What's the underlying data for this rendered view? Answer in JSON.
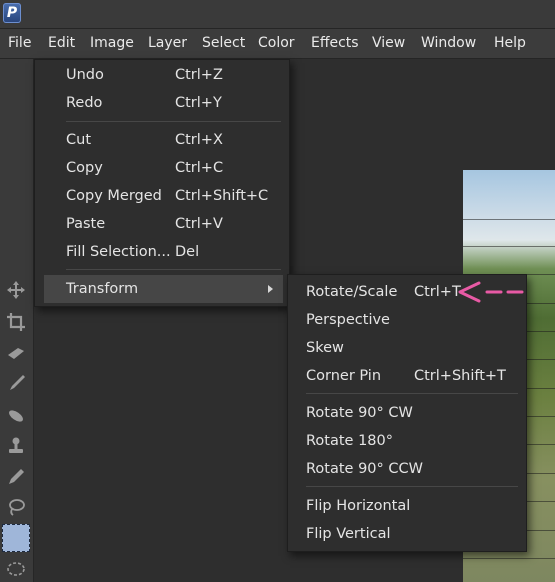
{
  "app": {
    "logo_letter": "P"
  },
  "menubar": [
    "File",
    "Edit",
    "Image",
    "Layer",
    "Select",
    "Color",
    "Effects",
    "View",
    "Window",
    "Help"
  ],
  "edit_menu": {
    "items": [
      {
        "label": "Undo",
        "shortcut": "Ctrl+Z"
      },
      {
        "label": "Redo",
        "shortcut": "Ctrl+Y"
      },
      {
        "label": "Cut",
        "shortcut": "Ctrl+X"
      },
      {
        "label": "Copy",
        "shortcut": "Ctrl+C"
      },
      {
        "label": "Copy Merged",
        "shortcut": "Ctrl+Shift+C"
      },
      {
        "label": "Paste",
        "shortcut": "Ctrl+V"
      },
      {
        "label": "Fill Selection...",
        "shortcut": "Del"
      },
      {
        "label": "Transform",
        "shortcut": ""
      }
    ],
    "highlighted": "Transform"
  },
  "transform_submenu": {
    "items": [
      {
        "label": "Rotate/Scale",
        "shortcut": "Ctrl+T"
      },
      {
        "label": "Perspective",
        "shortcut": ""
      },
      {
        "label": "Skew",
        "shortcut": ""
      },
      {
        "label": "Corner Pin",
        "shortcut": "Ctrl+Shift+T"
      },
      {
        "label": "Rotate 90° CW",
        "shortcut": ""
      },
      {
        "label": "Rotate 180°",
        "shortcut": ""
      },
      {
        "label": "Rotate 90° CCW",
        "shortcut": ""
      },
      {
        "label": "Flip Horizontal",
        "shortcut": ""
      },
      {
        "label": "Flip Vertical",
        "shortcut": ""
      }
    ]
  },
  "tools": [
    "move-icon",
    "crop-icon",
    "eraser-icon",
    "brush-icon",
    "smudge-icon",
    "clone-stamp-icon",
    "pen-icon",
    "lasso-icon",
    "rect-select-icon",
    "ellipse-select-icon"
  ],
  "colors": {
    "annotation": "#e85aa5",
    "highlight": "#464646",
    "menu_bg": "#2e2e2e",
    "active_tool": "#9fb6d9"
  }
}
